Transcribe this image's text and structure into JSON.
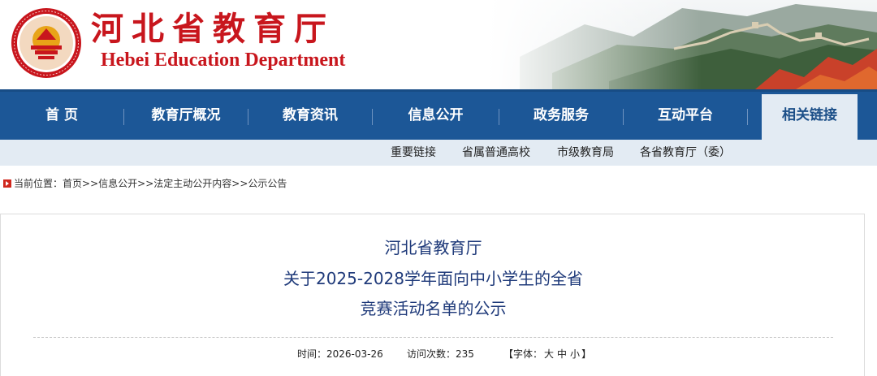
{
  "header": {
    "title_cn": "河北省教育厅",
    "title_en": "Hebei Education Department",
    "emblem_icon": "education-department-emblem-icon",
    "banner_image": "great-wall-landscape",
    "brand_color": "#c8161d"
  },
  "nav": {
    "color": "#1c5797",
    "items": [
      {
        "label": "首 页"
      },
      {
        "label": "教育厅概况"
      },
      {
        "label": "教育资讯"
      },
      {
        "label": "信息公开"
      },
      {
        "label": "政务服务"
      },
      {
        "label": "互动平台"
      },
      {
        "label": "相关链接",
        "active": true
      }
    ]
  },
  "subnav": {
    "items": [
      {
        "label": "重要链接"
      },
      {
        "label": "省属普通高校"
      },
      {
        "label": "市级教育局"
      },
      {
        "label": "各省教育厅（委）"
      }
    ]
  },
  "breadcrumb": {
    "prefix": "当前位置：",
    "items": [
      "首页",
      "信息公开",
      "法定主动公开内容",
      "公示公告"
    ],
    "separator": ">>"
  },
  "article": {
    "title_lines": [
      "河北省教育厅",
      "关于2025-2028学年面向中小学生的全省",
      "竞赛活动名单的公示"
    ],
    "meta": {
      "time_label": "时间：",
      "time_value": "2026-03-26",
      "visits_label": "访问次数：",
      "visits_value": "235",
      "font_open": "【字体：",
      "font_large": "大",
      "font_medium": "中",
      "font_small": "小",
      "font_close": "】"
    }
  }
}
